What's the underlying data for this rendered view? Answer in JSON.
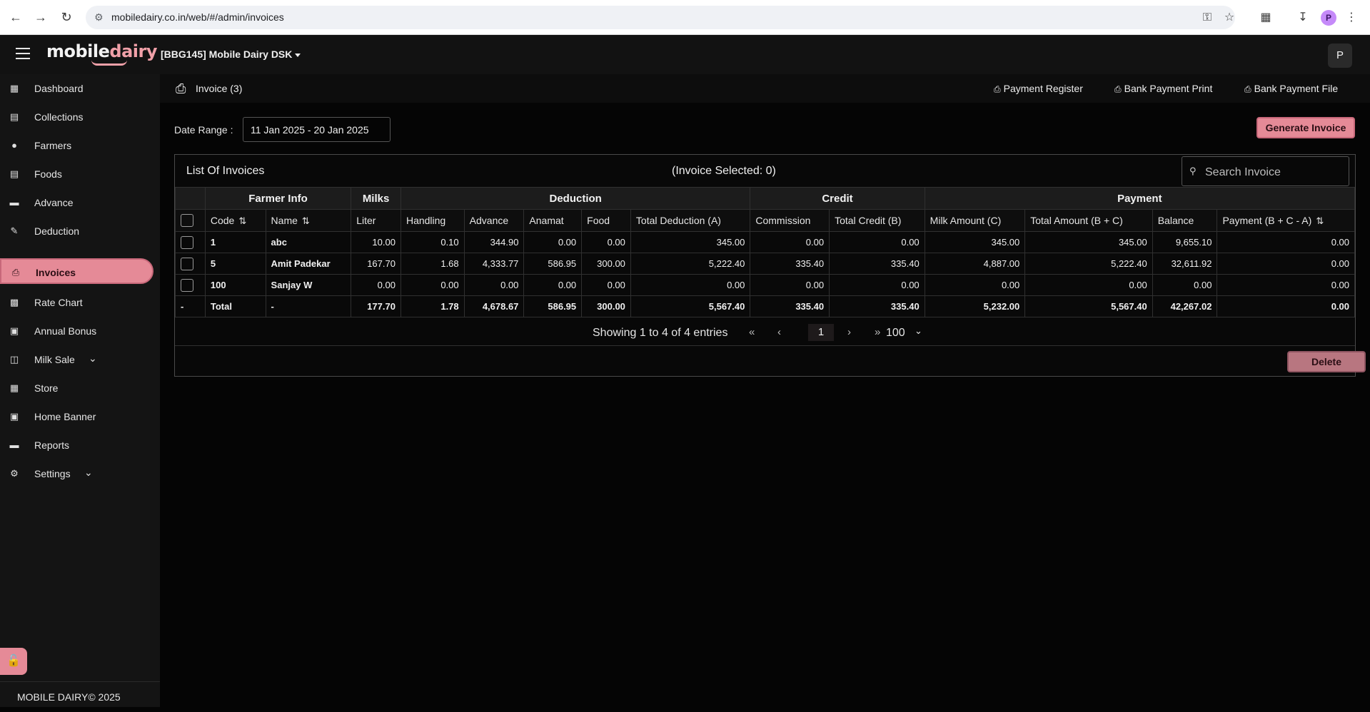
{
  "browser": {
    "url": "mobiledairy.co.in/web/#/admin/invoices",
    "profile_initial": "P"
  },
  "header": {
    "logo_part1": "mobile",
    "logo_part2": "dairy",
    "dairy_name": "[BBG145] Mobile Dairy DSK",
    "user_initial": "P"
  },
  "sidebar": {
    "items": [
      {
        "label": "Dashboard",
        "icon": "dashboard-icon"
      },
      {
        "label": "Collections",
        "icon": "collections-icon"
      },
      {
        "label": "Farmers",
        "icon": "person-icon"
      },
      {
        "label": "Foods",
        "icon": "book-icon"
      },
      {
        "label": "Advance",
        "icon": "card-icon"
      },
      {
        "label": "Deduction",
        "icon": "deduction-icon"
      },
      {
        "label": "Invoices",
        "icon": "print-icon"
      },
      {
        "label": "Rate Chart",
        "icon": "bar-chart-icon"
      },
      {
        "label": "Annual Bonus",
        "icon": "gift-icon"
      },
      {
        "label": "Milk Sale",
        "icon": "library-icon"
      },
      {
        "label": "Store",
        "icon": "store-icon"
      },
      {
        "label": "Home Banner",
        "icon": "image-icon"
      },
      {
        "label": "Reports",
        "icon": "folder-icon"
      },
      {
        "label": "Settings",
        "icon": "gear-icon"
      }
    ],
    "footer": "MOBILE DAIRY© 2025"
  },
  "page": {
    "title": "Invoice (3)",
    "links": {
      "payment_register": "Payment Register",
      "bank_payment_print": "Bank Payment Print",
      "bank_payment_file": "Bank Payment File"
    },
    "date_label": "Date Range :",
    "date_value": "11 Jan 2025 - 20 Jan 2025",
    "generate_button": "Generate Invoice",
    "list_title": "List Of Invoices",
    "selected_text": "(Invoice Selected: 0)",
    "search_placeholder": "Search Invoice",
    "delete_button": "Delete"
  },
  "table": {
    "groups": [
      "Farmer Info",
      "Milks",
      "Deduction",
      "Credit",
      "Payment"
    ],
    "columns": [
      "Code",
      "Name",
      "Liter",
      "Handling",
      "Advance",
      "Anamat",
      "Food",
      "Total Deduction (A)",
      "Commission",
      "Total Credit (B)",
      "Milk Amount (C)",
      "Total Amount (B + C)",
      "Balance",
      "Payment (B + C - A)"
    ],
    "rows": [
      {
        "code": "1",
        "name": "abc",
        "liter": "10.00",
        "handling": "0.10",
        "advance": "344.90",
        "anamat": "0.00",
        "food": "0.00",
        "total_deduction": "345.00",
        "commission": "0.00",
        "total_credit": "0.00",
        "milk_amount": "345.00",
        "total_amount": "345.00",
        "balance": "9,655.10",
        "payment": "0.00"
      },
      {
        "code": "5",
        "name": "Amit Padekar",
        "liter": "167.70",
        "handling": "1.68",
        "advance": "4,333.77",
        "anamat": "586.95",
        "food": "300.00",
        "total_deduction": "5,222.40",
        "commission": "335.40",
        "total_credit": "335.40",
        "milk_amount": "4,887.00",
        "total_amount": "5,222.40",
        "balance": "32,611.92",
        "payment": "0.00"
      },
      {
        "code": "100",
        "name": "Sanjay W",
        "liter": "0.00",
        "handling": "0.00",
        "advance": "0.00",
        "anamat": "0.00",
        "food": "0.00",
        "total_deduction": "0.00",
        "commission": "0.00",
        "total_credit": "0.00",
        "milk_amount": "0.00",
        "total_amount": "0.00",
        "balance": "0.00",
        "payment": "0.00"
      }
    ],
    "total": {
      "marker": "-",
      "code": "Total",
      "name": "-",
      "liter": "177.70",
      "handling": "1.78",
      "advance": "4,678.67",
      "anamat": "586.95",
      "food": "300.00",
      "total_deduction": "5,567.40",
      "commission": "335.40",
      "total_credit": "335.40",
      "milk_amount": "5,232.00",
      "total_amount": "5,567.40",
      "balance": "42,267.02",
      "payment": "0.00"
    }
  },
  "pagination": {
    "info": "Showing 1 to 4 of 4 entries",
    "first": "«",
    "prev": "‹",
    "current": "1",
    "next": "›",
    "last": "»",
    "page_size": "100"
  },
  "colors": {
    "accent": "#e58a97",
    "background": "#050505",
    "sidebar": "#141414"
  }
}
